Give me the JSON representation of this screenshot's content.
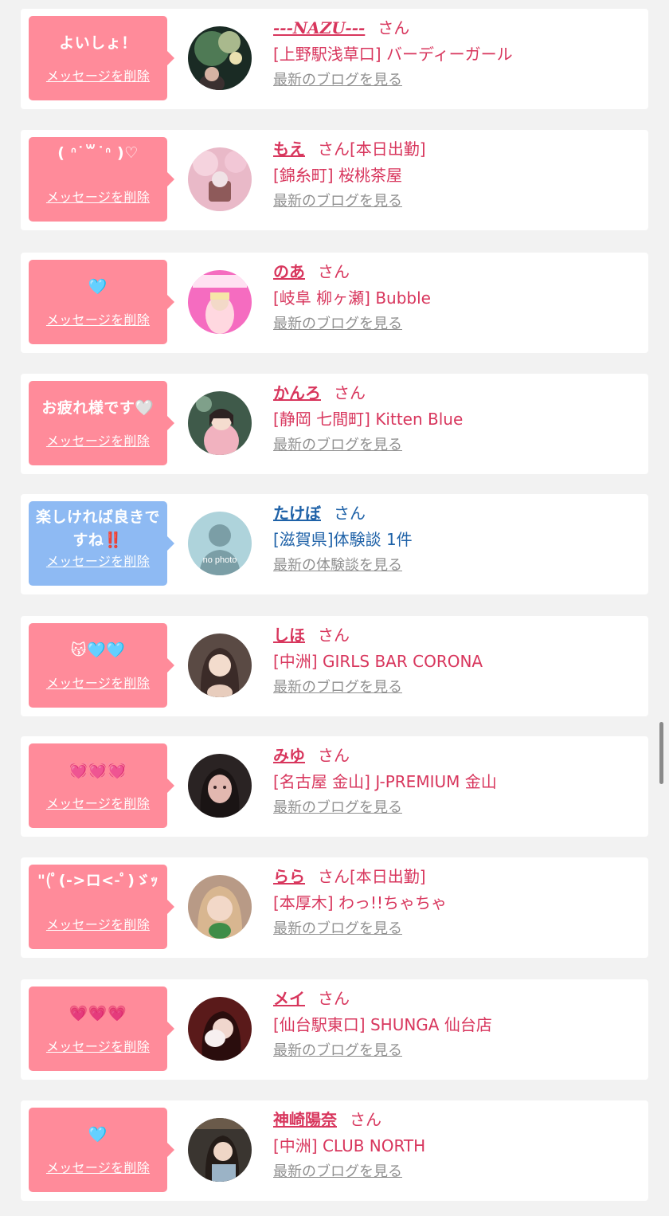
{
  "delete_label": "メッセージを削除",
  "san_label": "さん",
  "colors": {
    "pink_bubble": "#ff8b9a",
    "blue_bubble": "#8ebaf3",
    "pink_text": "#d8365d",
    "blue_text": "#1f62a8"
  },
  "cards": [
    {
      "message": "よいしょ！",
      "name": "---NAZU---",
      "suffix": "",
      "shop": "[上野駅浅草口] バーディーガール",
      "blog_link": "最新のブログを見る",
      "theme": "pink",
      "avatar_icon": "night-scene-photo"
    },
    {
      "message": "( ᐢ˙꒳˙ᐢ )♡",
      "name": "もえ",
      "suffix": "[本日出勤]",
      "shop": "[錦糸町] 桜桃茶屋",
      "blog_link": "最新のブログを見る",
      "theme": "pink",
      "avatar_icon": "cherry-blossom-photo"
    },
    {
      "message": "🩵",
      "name": "のあ",
      "suffix": "",
      "shop": "[岐阜 柳ヶ瀬] Bubble",
      "blog_link": "最新のブログを見る",
      "theme": "pink",
      "avatar_icon": "bubble-magazine-photo"
    },
    {
      "message": "お疲れ様です🤍",
      "name": "かんろ",
      "suffix": "",
      "shop": "[静岡 七間町] Kitten Blue",
      "blog_link": "最新のブログを見る",
      "theme": "pink",
      "avatar_icon": "portrait-photo"
    },
    {
      "message": "楽しければ良きですね‼️",
      "name": "たけぼ",
      "suffix": "",
      "shop": "[滋賀県]体験談 1件",
      "blog_link": "最新の体験談を見る",
      "theme": "blue",
      "avatar_icon": "no-photo-silhouette",
      "avatar_text": "no photo"
    },
    {
      "message": "😽🩵🩵",
      "name": "しほ",
      "suffix": "",
      "shop": "[中洲] GIRLS BAR CORONA",
      "blog_link": "最新のブログを見る",
      "theme": "pink",
      "avatar_icon": "portrait-photo"
    },
    {
      "message": "💓💓💓",
      "name": "みゆ",
      "suffix": "",
      "shop": "[名古屋 金山] J-PREMIUM 金山",
      "blog_link": "最新のブログを見る",
      "theme": "pink",
      "avatar_icon": "portrait-photo"
    },
    {
      "message": "\"(ﾟ(->ロ<-ﾟ)ゞｯ",
      "name": "らら",
      "suffix": "[本日出勤]",
      "shop": "[本厚木] わっ!!ちゃちゃ",
      "blog_link": "最新のブログを見る",
      "theme": "pink",
      "avatar_icon": "portrait-photo"
    },
    {
      "message": "💗💗💗",
      "name": "メイ",
      "suffix": "",
      "shop": "[仙台駅東口] SHUNGA 仙台店",
      "blog_link": "最新のブログを見る",
      "theme": "pink",
      "avatar_icon": "portrait-photo"
    },
    {
      "message": "🩵",
      "name": "神崎陽奈",
      "suffix": "",
      "shop": "[中洲] CLUB NORTH",
      "blog_link": "最新のブログを見る",
      "theme": "pink",
      "avatar_icon": "portrait-photo"
    }
  ]
}
